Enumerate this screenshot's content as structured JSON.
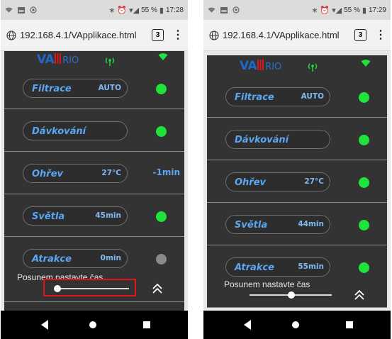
{
  "screens": [
    {
      "status": {
        "bt_glyph": "∗",
        "alarm_glyph": "⏰",
        "signal_glyph": "▾◢",
        "battery_pct": "55 %",
        "battery_glyph": "▮",
        "time": "17:28"
      },
      "browser": {
        "url": "192.168.4.1/VApplikace.html",
        "tab_count": "3",
        "menu_glyph": "⋮"
      },
      "app": {
        "logo": {
          "va": "VA",
          "rio": "RIO"
        },
        "rows": [
          {
            "label": "Filtrace",
            "value": "AUTO",
            "indicator": "on",
            "status_text": ""
          },
          {
            "label": "Dávkování",
            "value": "",
            "indicator": "on",
            "status_text": ""
          },
          {
            "label": "Ohřev",
            "value": "27°C",
            "indicator": "text",
            "status_text": "-1min"
          },
          {
            "label": "Světla",
            "value": "45min",
            "indicator": "on",
            "status_text": ""
          },
          {
            "label": "Atrakce",
            "value": "0min",
            "indicator": "off",
            "status_text": ""
          }
        ],
        "slider": {
          "label": "Posunem nastavte čas",
          "level": 0.08
        }
      }
    },
    {
      "status": {
        "bt_glyph": "∗",
        "alarm_glyph": "⏰",
        "signal_glyph": "▾◢",
        "battery_pct": "55 %",
        "battery_glyph": "▮",
        "time": "17:29"
      },
      "browser": {
        "url": "192.168.4.1/VApplikace.html",
        "tab_count": "3",
        "menu_glyph": "⋮"
      },
      "app": {
        "logo": {
          "va": "VA",
          "rio": "RIO"
        },
        "rows": [
          {
            "label": "Filtrace",
            "value": "AUTO",
            "indicator": "on",
            "status_text": ""
          },
          {
            "label": "Dávkování",
            "value": "",
            "indicator": "on",
            "status_text": ""
          },
          {
            "label": "Ohřev",
            "value": "27°C",
            "indicator": "on",
            "status_text": ""
          },
          {
            "label": "Světla",
            "value": "44min",
            "indicator": "on",
            "status_text": ""
          },
          {
            "label": "Atrakce",
            "value": "55min",
            "indicator": "on",
            "status_text": ""
          }
        ],
        "slider": {
          "label": "Posunem nastavte čas",
          "level": 0.55
        }
      }
    }
  ],
  "colors": {
    "accent_blue": "#5aa6f2",
    "led_on": "#1fe23a",
    "led_off": "#8a8a8a",
    "wifi_green": "#1fe23a",
    "highlight_red": "#e0141a"
  },
  "icons": [
    "wifi-icon",
    "bluetooth-icon",
    "alarm-icon",
    "signal-icon",
    "battery-icon",
    "globe-icon",
    "tabs-icon",
    "kebab-menu-icon",
    "antenna-icon",
    "collapse-up-icon",
    "nav-back-icon",
    "nav-home-icon",
    "nav-recent-icon"
  ]
}
